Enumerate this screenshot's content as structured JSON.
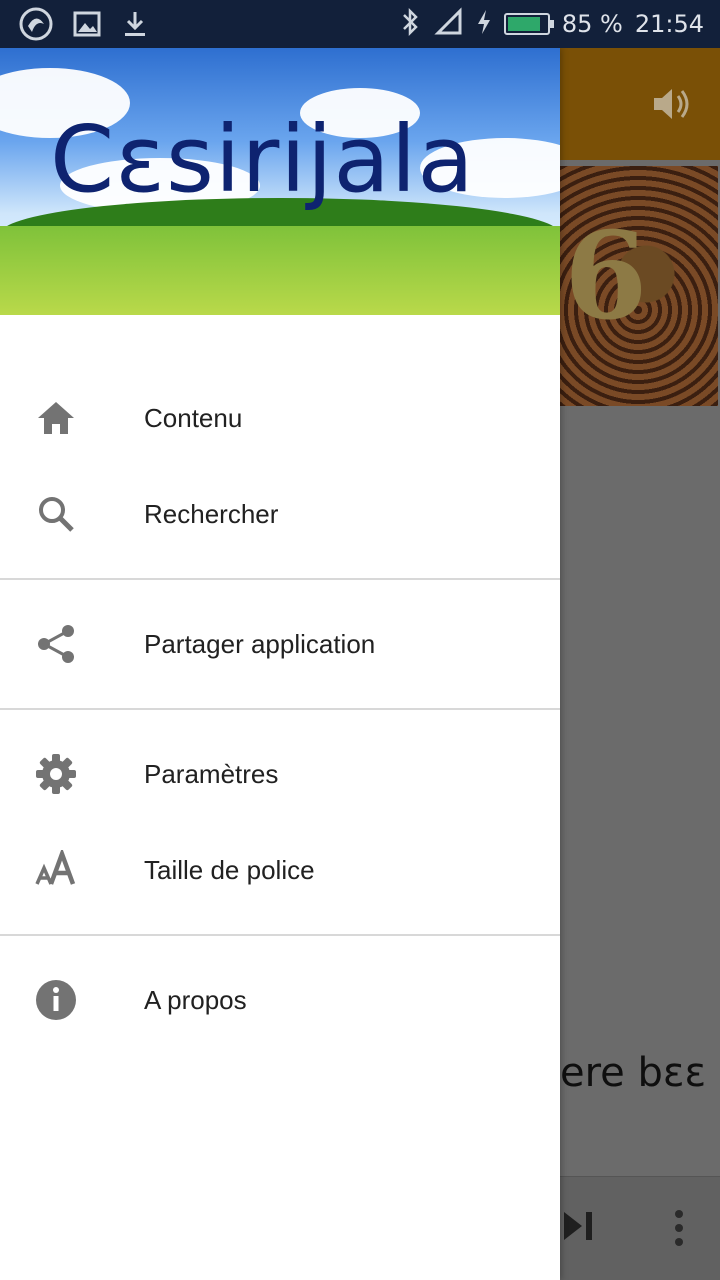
{
  "status_bar": {
    "battery_text": "85 %",
    "time": "21:54",
    "battery_level": 0.85,
    "battery_color": "#2ea86a"
  },
  "drawer": {
    "header_title": "Cεsirijala",
    "groups": [
      {
        "items": [
          {
            "icon": "home-icon",
            "label": "Contenu"
          },
          {
            "icon": "search-icon",
            "label": "Rechercher"
          }
        ]
      },
      {
        "items": [
          {
            "icon": "share-icon",
            "label": "Partager application"
          }
        ]
      },
      {
        "items": [
          {
            "icon": "settings-icon",
            "label": "Paramètres"
          },
          {
            "icon": "font-size-icon",
            "label": "Taille de police"
          }
        ]
      },
      {
        "items": [
          {
            "icon": "info-icon",
            "label": "A propos"
          }
        ]
      }
    ]
  },
  "background_app": {
    "visible_text": "ere bεε",
    "image_glyph": "6",
    "topbar_color": "#7a5006"
  }
}
